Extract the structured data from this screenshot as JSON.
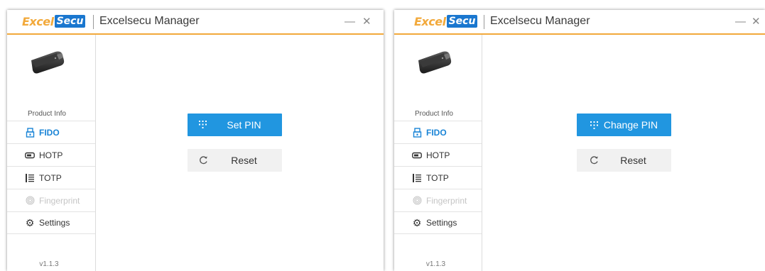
{
  "windows": [
    {
      "logo": {
        "part1": "Excel",
        "part2": "Secu"
      },
      "title": "Excelsecu Manager",
      "controls": {
        "minimize": "—",
        "close": "✕"
      },
      "sidebar": {
        "product_info": "Product Info",
        "items": [
          {
            "label": "FIDO",
            "icon": "fido-key-icon",
            "state": "active"
          },
          {
            "label": "HOTP",
            "icon": "hotp-token-icon",
            "state": "normal"
          },
          {
            "label": "TOTP",
            "icon": "totp-list-icon",
            "state": "normal"
          },
          {
            "label": "Fingerprint",
            "icon": "fingerprint-icon",
            "state": "disabled"
          },
          {
            "label": "Settings",
            "icon": "gear-icon",
            "state": "normal"
          }
        ],
        "version": "v1.1.3"
      },
      "main": {
        "primary_button": "Set PIN",
        "secondary_button": "Reset"
      }
    },
    {
      "logo": {
        "part1": "Excel",
        "part2": "Secu"
      },
      "title": "Excelsecu Manager",
      "controls": {
        "minimize": "—",
        "close": "✕"
      },
      "sidebar": {
        "product_info": "Product Info",
        "items": [
          {
            "label": "FIDO",
            "icon": "fido-key-icon",
            "state": "active"
          },
          {
            "label": "HOTP",
            "icon": "hotp-token-icon",
            "state": "normal"
          },
          {
            "label": "TOTP",
            "icon": "totp-list-icon",
            "state": "normal"
          },
          {
            "label": "Fingerprint",
            "icon": "fingerprint-icon",
            "state": "disabled"
          },
          {
            "label": "Settings",
            "icon": "gear-icon",
            "state": "normal"
          }
        ],
        "version": "v1.1.3"
      },
      "main": {
        "primary_button": "Change PIN",
        "secondary_button": "Reset"
      }
    }
  ],
  "colors": {
    "accent": "#2196e0",
    "brand_orange": "#f2a93b",
    "brand_blue": "#1a77cf",
    "active_nav": "#1a84d6",
    "disabled": "#c5c5c5"
  }
}
